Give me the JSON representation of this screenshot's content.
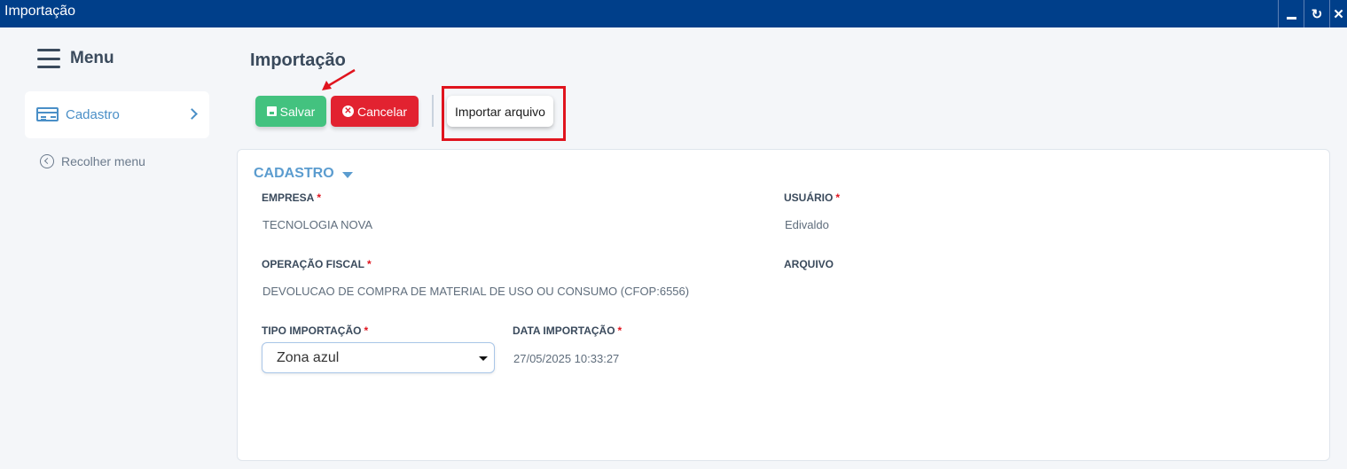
{
  "window": {
    "title": "Importação",
    "controls": {
      "minimize": "minimize-icon",
      "restore": "refresh-icon",
      "close": "close-icon"
    }
  },
  "sidebar": {
    "menu_label": "Menu",
    "items": [
      {
        "label": "Cadastro",
        "icon": "id-card-icon"
      }
    ],
    "collapse_label": "Recolher menu"
  },
  "page": {
    "title": "Importação"
  },
  "toolbar": {
    "save_label": "Salvar",
    "cancel_label": "Cancelar",
    "import_label": "Importar arquivo"
  },
  "form": {
    "section_title": "CADASTRO",
    "required_mark": "*",
    "empresa": {
      "label": "EMPRESA",
      "value": "TECNOLOGIA NOVA"
    },
    "usuario": {
      "label": "USUÁRIO",
      "value": "Edivaldo"
    },
    "operacao_fiscal": {
      "label": "OPERAÇÃO FISCAL",
      "value": "DEVOLUCAO DE COMPRA DE MATERIAL DE USO OU CONSUMO (CFOP:6556)"
    },
    "arquivo": {
      "label": "ARQUIVO"
    },
    "tipo_importacao": {
      "label": "TIPO IMPORTAÇÃO",
      "value": "Zona azul"
    },
    "data_importacao": {
      "label": "DATA IMPORTAÇÃO",
      "value": "27/05/2025 10:33:27"
    }
  },
  "colors": {
    "titlebar": "#003f8a",
    "save": "#43c27f",
    "cancel": "#e22230",
    "accent": "#5b9ccf",
    "annotation": "#e0141e"
  }
}
